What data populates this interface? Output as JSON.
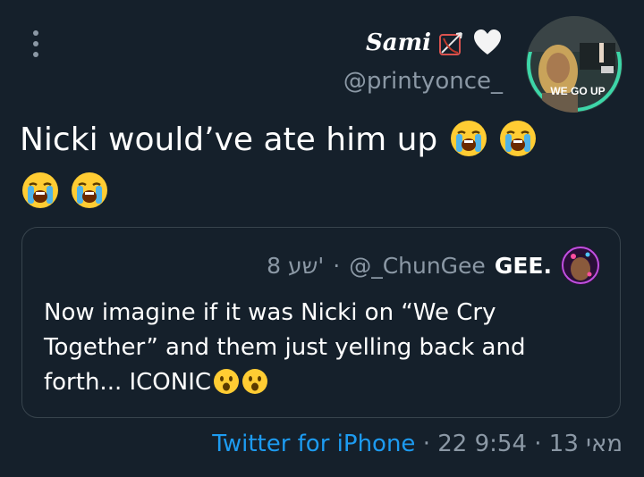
{
  "tweet": {
    "display_name": "Sami",
    "handle": "@printyonce_",
    "text": "Nicki would’ve ate him up",
    "emojis": [
      "loudly-crying-face",
      "loudly-crying-face",
      "loudly-crying-face",
      "loudly-crying-face"
    ],
    "avatar_caption": "WE GO UP"
  },
  "quote": {
    "name": "GEE.",
    "handle": "@_ChunGee",
    "separator": "·",
    "time": "8 שע'",
    "text": "Now imagine if it was Nicki on “We Cry Together” and them just yelling back and forth... ICONIC",
    "emojis": [
      "hushed-face",
      "hushed-face"
    ]
  },
  "footer": {
    "source": "Twitter for iPhone",
    "separator": "·",
    "date": "22 מאי 13",
    "time": "9:54"
  },
  "colors": {
    "background": "#15202b",
    "text": "#ffffff",
    "muted": "#8b98a5",
    "link": "#1d9bf0",
    "border": "#38444d"
  }
}
